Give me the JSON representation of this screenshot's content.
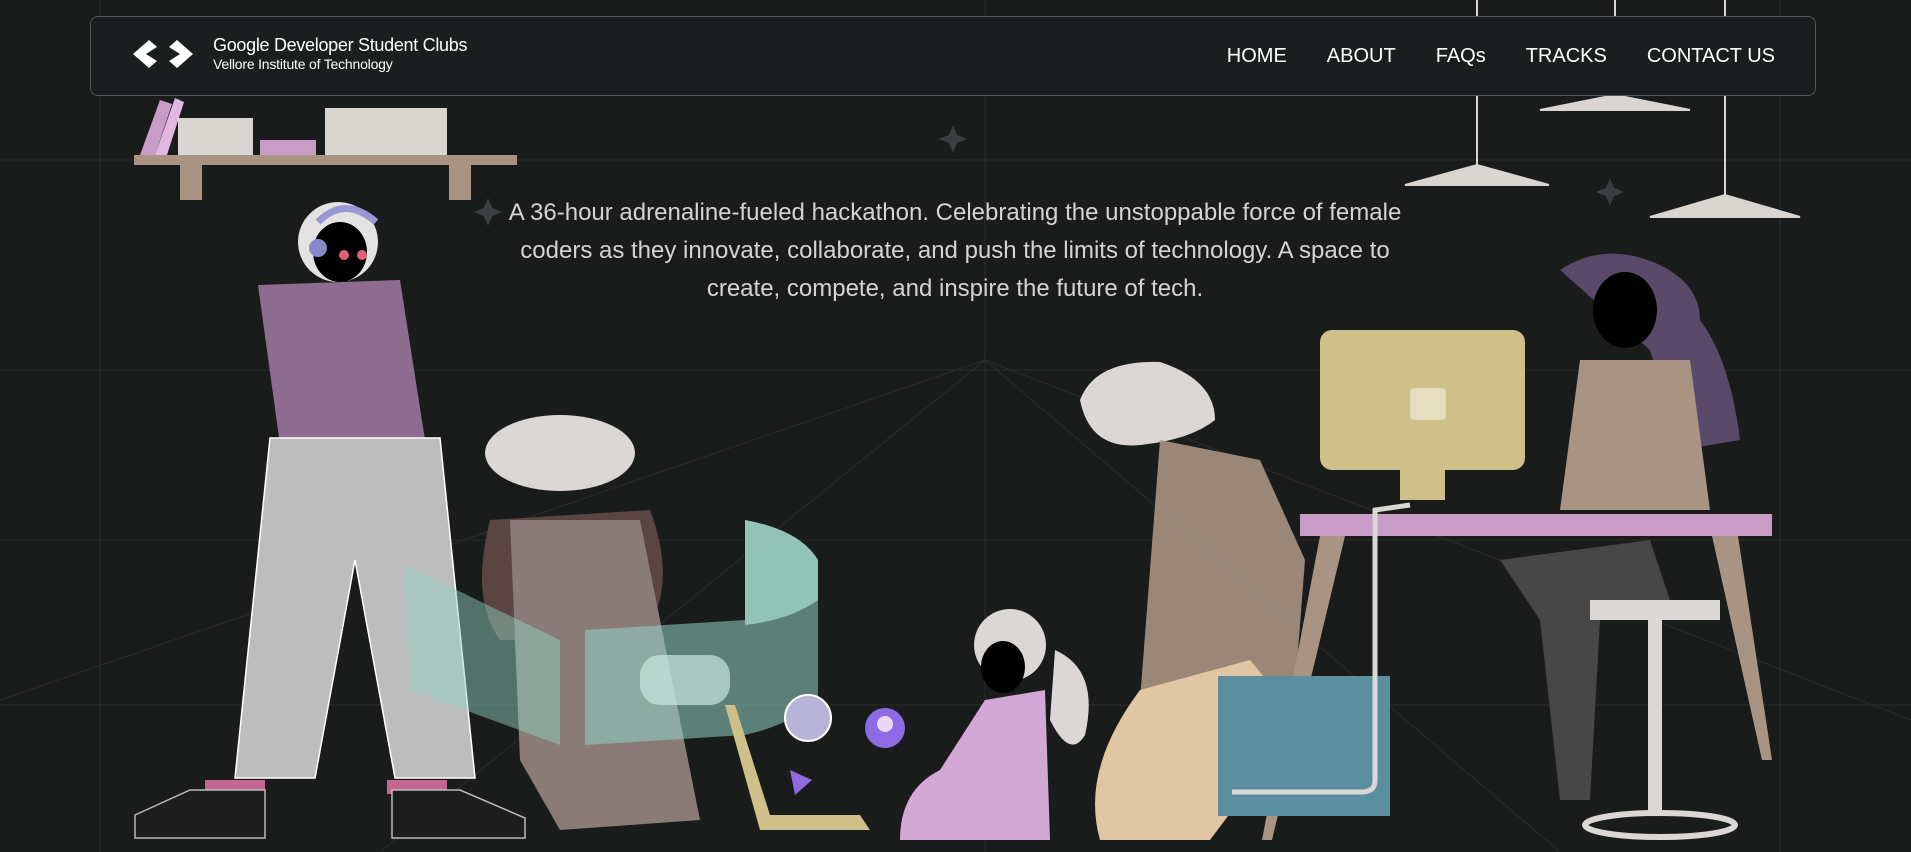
{
  "brand": {
    "title": "Google Developer Student Clubs",
    "subtitle": "Vellore Institute of Technology",
    "logo_icon": "gdsc-brackets-logo"
  },
  "nav": {
    "items": [
      {
        "label": "HOME"
      },
      {
        "label": "ABOUT"
      },
      {
        "label": "FAQs"
      },
      {
        "label": "TRACKS"
      },
      {
        "label": "CONTACT US"
      }
    ]
  },
  "hero": {
    "description": "A 36-hour adrenaline-fueled hackathon. Celebrating the unstoppable force of female coders as they innovate, collaborate, and push the limits of technology. A space to create, compete, and inspire the future of tech."
  },
  "colors": {
    "background": "#1a1b1b",
    "text": "#d4d4d4",
    "nav_border": "#55585a",
    "accent_purple": "#8d6c8f",
    "accent_teal": "#8fd3c3",
    "accent_gold": "#cfbf88",
    "accent_pink": "#c99bc7"
  }
}
